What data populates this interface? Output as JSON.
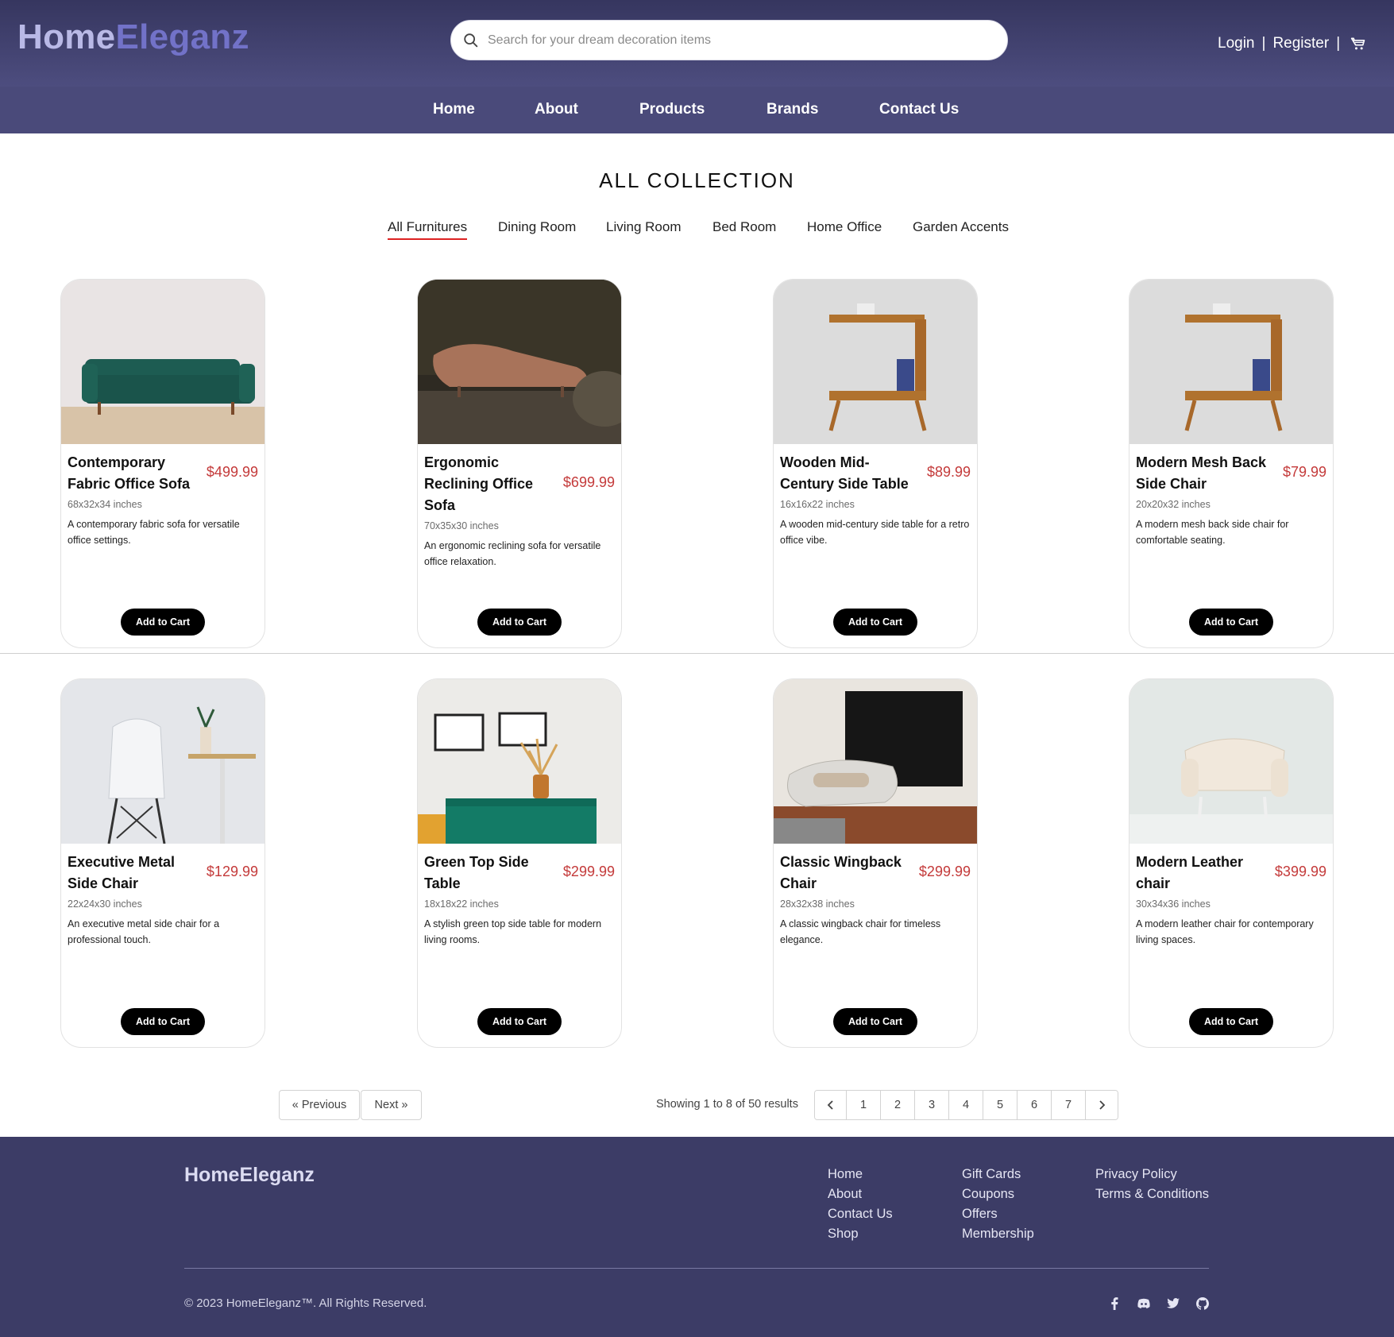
{
  "header": {
    "logo_part1": "Home",
    "logo_part2": "Eleganz",
    "search_placeholder": "Search for your dream decoration items",
    "login": "Login",
    "register": "Register",
    "separator": "|",
    "search_icon": "search-icon",
    "cart_icon": "cart-icon"
  },
  "nav": [
    "Home",
    "About",
    "Products",
    "Brands",
    "Contact Us"
  ],
  "collection": {
    "title": "ALL COLLECTION",
    "categories": [
      "All Furnitures",
      "Dining Room",
      "Living Room",
      "Bed Room",
      "Home Office",
      "Garden Accents"
    ],
    "active_category": "All Furnitures"
  },
  "products": [
    {
      "name": "Contemporary Fabric Office Sofa",
      "price": "$499.99",
      "dims": "68x32x34 inches",
      "desc": "A contemporary fabric sofa for versatile office settings.",
      "button": "Add to Cart"
    },
    {
      "name": "Ergonomic Reclining Office Sofa",
      "price": "$699.99",
      "dims": "70x35x30 inches",
      "desc": "An ergonomic reclining sofa for versatile office relaxation.",
      "button": "Add to Cart"
    },
    {
      "name": "Wooden Mid-Century Side Table",
      "price": "$89.99",
      "dims": "16x16x22 inches",
      "desc": "A wooden mid-century side table for a retro office vibe.",
      "button": "Add to Cart"
    },
    {
      "name": "Modern Mesh Back Side Chair",
      "price": "$79.99",
      "dims": "20x20x32 inches",
      "desc": "A modern mesh back side chair for comfortable seating.",
      "button": "Add to Cart"
    },
    {
      "name": "Executive Metal Side Chair",
      "price": "$129.99",
      "dims": "22x24x30 inches",
      "desc": "An executive metal side chair for a professional touch.",
      "button": "Add to Cart"
    },
    {
      "name": "Green Top Side Table",
      "price": "$299.99",
      "dims": "18x18x22 inches",
      "desc": "A stylish green top side table for modern living rooms.",
      "button": "Add to Cart"
    },
    {
      "name": "Classic Wingback Chair",
      "price": "$299.99",
      "dims": "28x32x38 inches",
      "desc": "A classic wingback chair for timeless elegance.",
      "button": "Add to Cart"
    },
    {
      "name": "Modern Leather chair",
      "price": "$399.99",
      "dims": "30x34x36 inches",
      "desc": "A modern leather chair for contemporary living spaces.",
      "button": "Add to Cart"
    }
  ],
  "pagination": {
    "previous": "« Previous",
    "next": "Next »",
    "results": "Showing 1 to 8 of 50 results",
    "pages": [
      "1",
      "2",
      "3",
      "4",
      "5",
      "6",
      "7"
    ],
    "prev_icon": "chevron-left-icon",
    "next_icon": "chevron-right-icon"
  },
  "footer": {
    "brand": "HomeEleganz",
    "col1": [
      "Home",
      "About",
      "Contact Us",
      "Shop"
    ],
    "col2": [
      "Gift Cards",
      "Coupons",
      "Offers",
      "Membership"
    ],
    "col3": [
      "Privacy Policy",
      "Terms & Conditions"
    ],
    "copyright": "© 2023 HomeEleganz™. All Rights Reserved.",
    "social_icons": [
      "facebook-icon",
      "discord-icon",
      "twitter-icon",
      "github-icon"
    ]
  },
  "colors": {
    "header_bg": "#4a4a7a",
    "footer_bg": "#3c3c66",
    "logo_light": "#b9b9e6",
    "logo_accent": "#7272c8",
    "price": "#c43a3a",
    "active_underline": "#dd2222",
    "button_bg": "#000000"
  }
}
